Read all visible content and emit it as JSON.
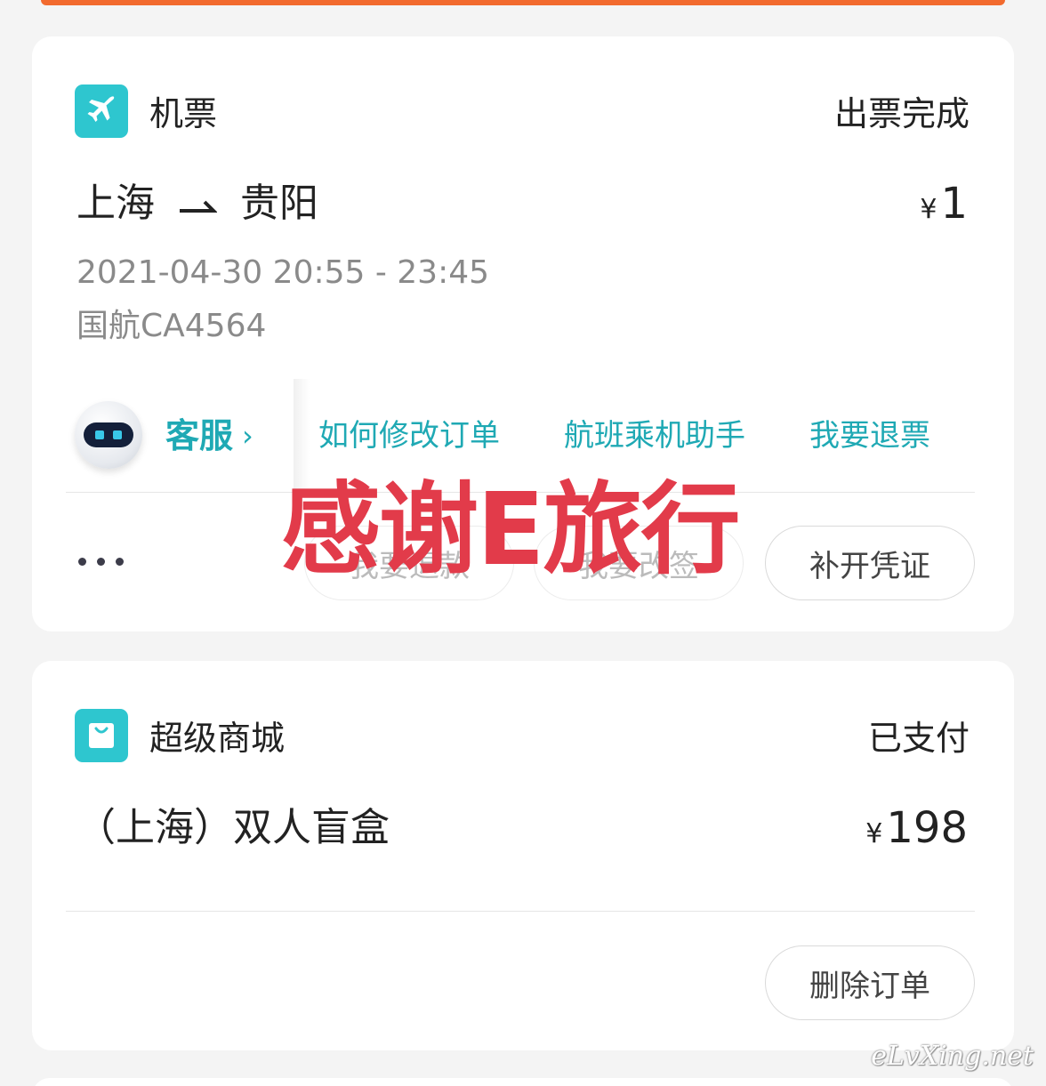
{
  "flight_order": {
    "category": "机票",
    "category_icon": "airplane-icon",
    "status": "出票完成",
    "origin": "上海",
    "destination": "贵阳",
    "price_currency": "¥",
    "price_value": "1",
    "datetime": "2021-04-30 20:55 - 23:45",
    "flight_no": "国航CA4564",
    "service": {
      "label": "客服",
      "chevron": "›",
      "avatar_icon": "robot-avatar-icon"
    },
    "quick_links": [
      "如何修改订单",
      "航班乘机助手",
      "我要退票"
    ],
    "more_label": "more-dots-icon",
    "actions": [
      "我要退款",
      "我要改签",
      "补开凭证"
    ]
  },
  "shop_order": {
    "category": "超级商城",
    "category_icon": "shopping-bag-icon",
    "status": "已支付",
    "product": "（上海）双人盲盒",
    "price_currency": "¥",
    "price_value": "198",
    "actions": [
      "删除订单"
    ]
  },
  "overlay": {
    "thanks_text": "感谢E旅行",
    "site_watermark": "eLvXing.net"
  },
  "colors": {
    "accent": "#1fa9b4",
    "icon_bg": "#2ec6cf",
    "watermark_red": "#e23b4a",
    "top_strip": "#f26a2e"
  }
}
